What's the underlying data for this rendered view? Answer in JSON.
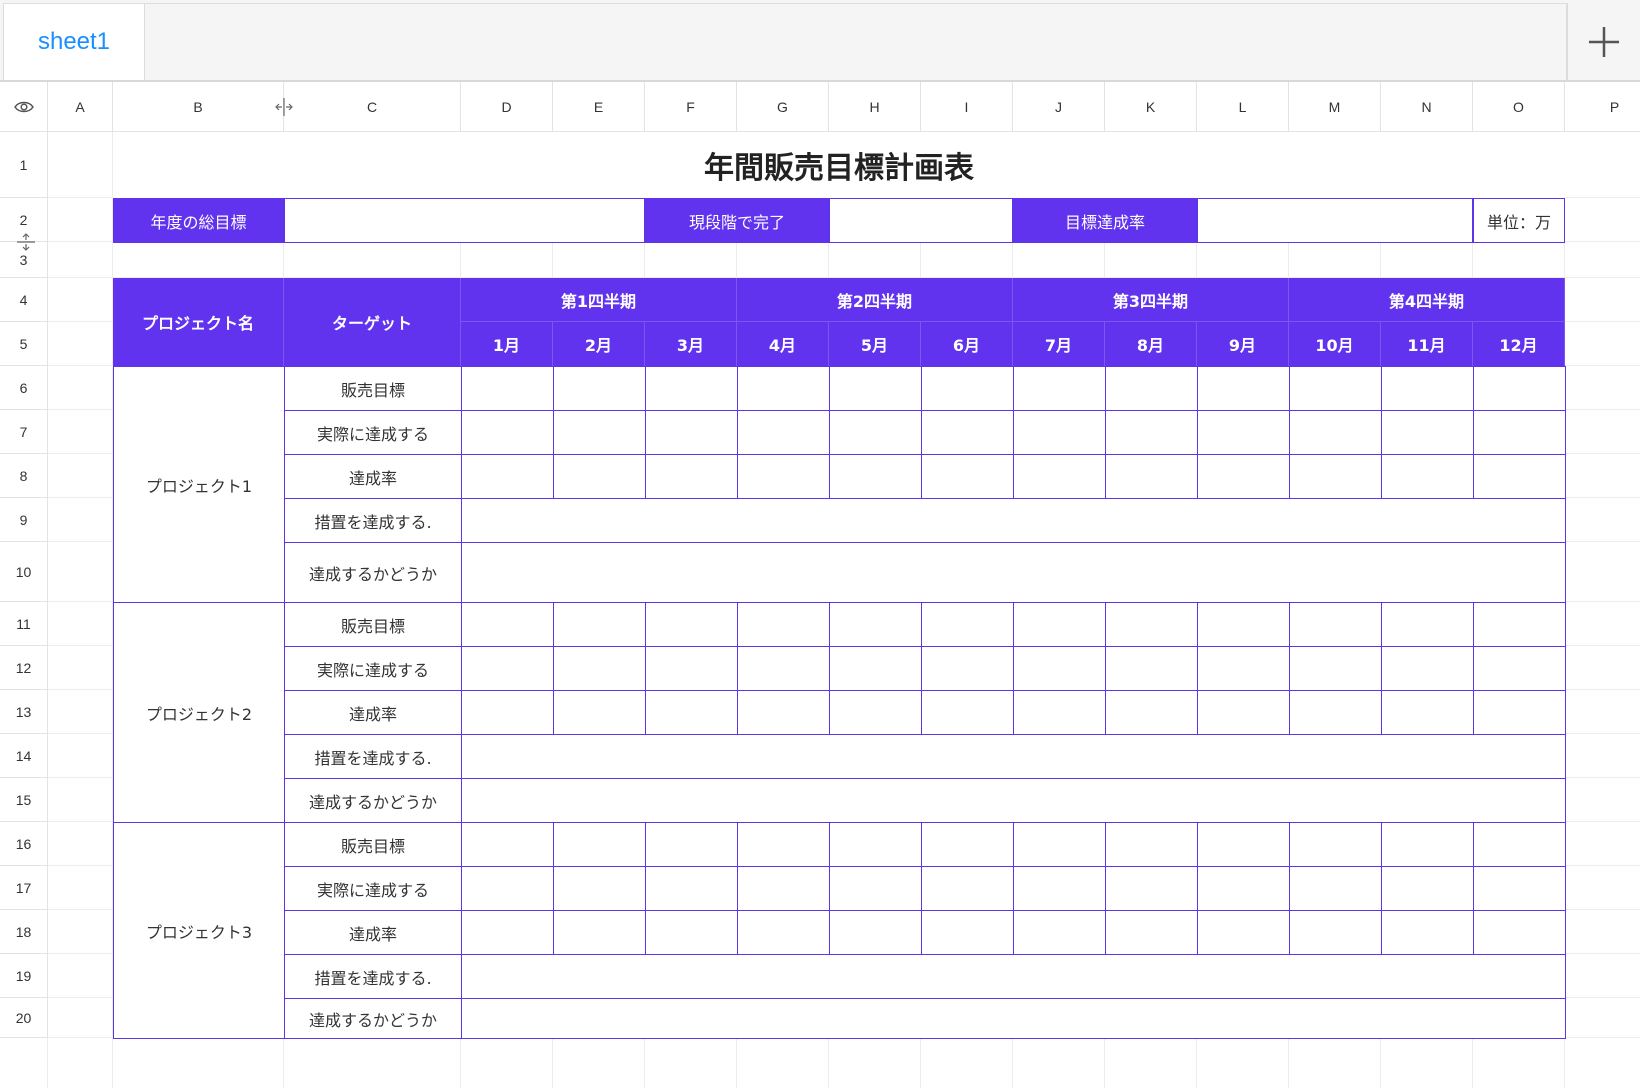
{
  "tabs": [
    {
      "label": "sheet1"
    }
  ],
  "colors": {
    "accent": "#6233ef",
    "tab_text": "#1890ff"
  },
  "columns": [
    "A",
    "B",
    "C",
    "D",
    "E",
    "F",
    "G",
    "H",
    "I",
    "J",
    "K",
    "L",
    "M",
    "N",
    "O",
    "P"
  ],
  "rows": [
    "1",
    "2",
    "3",
    "4",
    "5",
    "6",
    "7",
    "8",
    "9",
    "10",
    "11",
    "12",
    "13",
    "14",
    "15",
    "16",
    "17",
    "18",
    "19",
    "20"
  ],
  "sheet": {
    "title": "年間販売目標計画表",
    "summary": {
      "total_goal_label": "年度の総目標",
      "completed_label": "現段階で完了",
      "rate_label": "目標達成率",
      "unit_label": "単位：万"
    },
    "header": {
      "project_name": "プロジェクト名",
      "target": "ターゲット",
      "quarters": [
        "第1四半期",
        "第2四半期",
        "第3四半期",
        "第4四半期"
      ],
      "months": [
        "1月",
        "2月",
        "3月",
        "4月",
        "5月",
        "6月",
        "7月",
        "8月",
        "9月",
        "10月",
        "11月",
        "12月"
      ]
    },
    "targets": [
      "販売目標",
      "実際に達成する",
      "達成率",
      "措置を達成する.",
      "達成するかどうか"
    ],
    "projects": [
      "プロジェクト1",
      "プロジェクト2",
      "プロジェクト3"
    ]
  }
}
